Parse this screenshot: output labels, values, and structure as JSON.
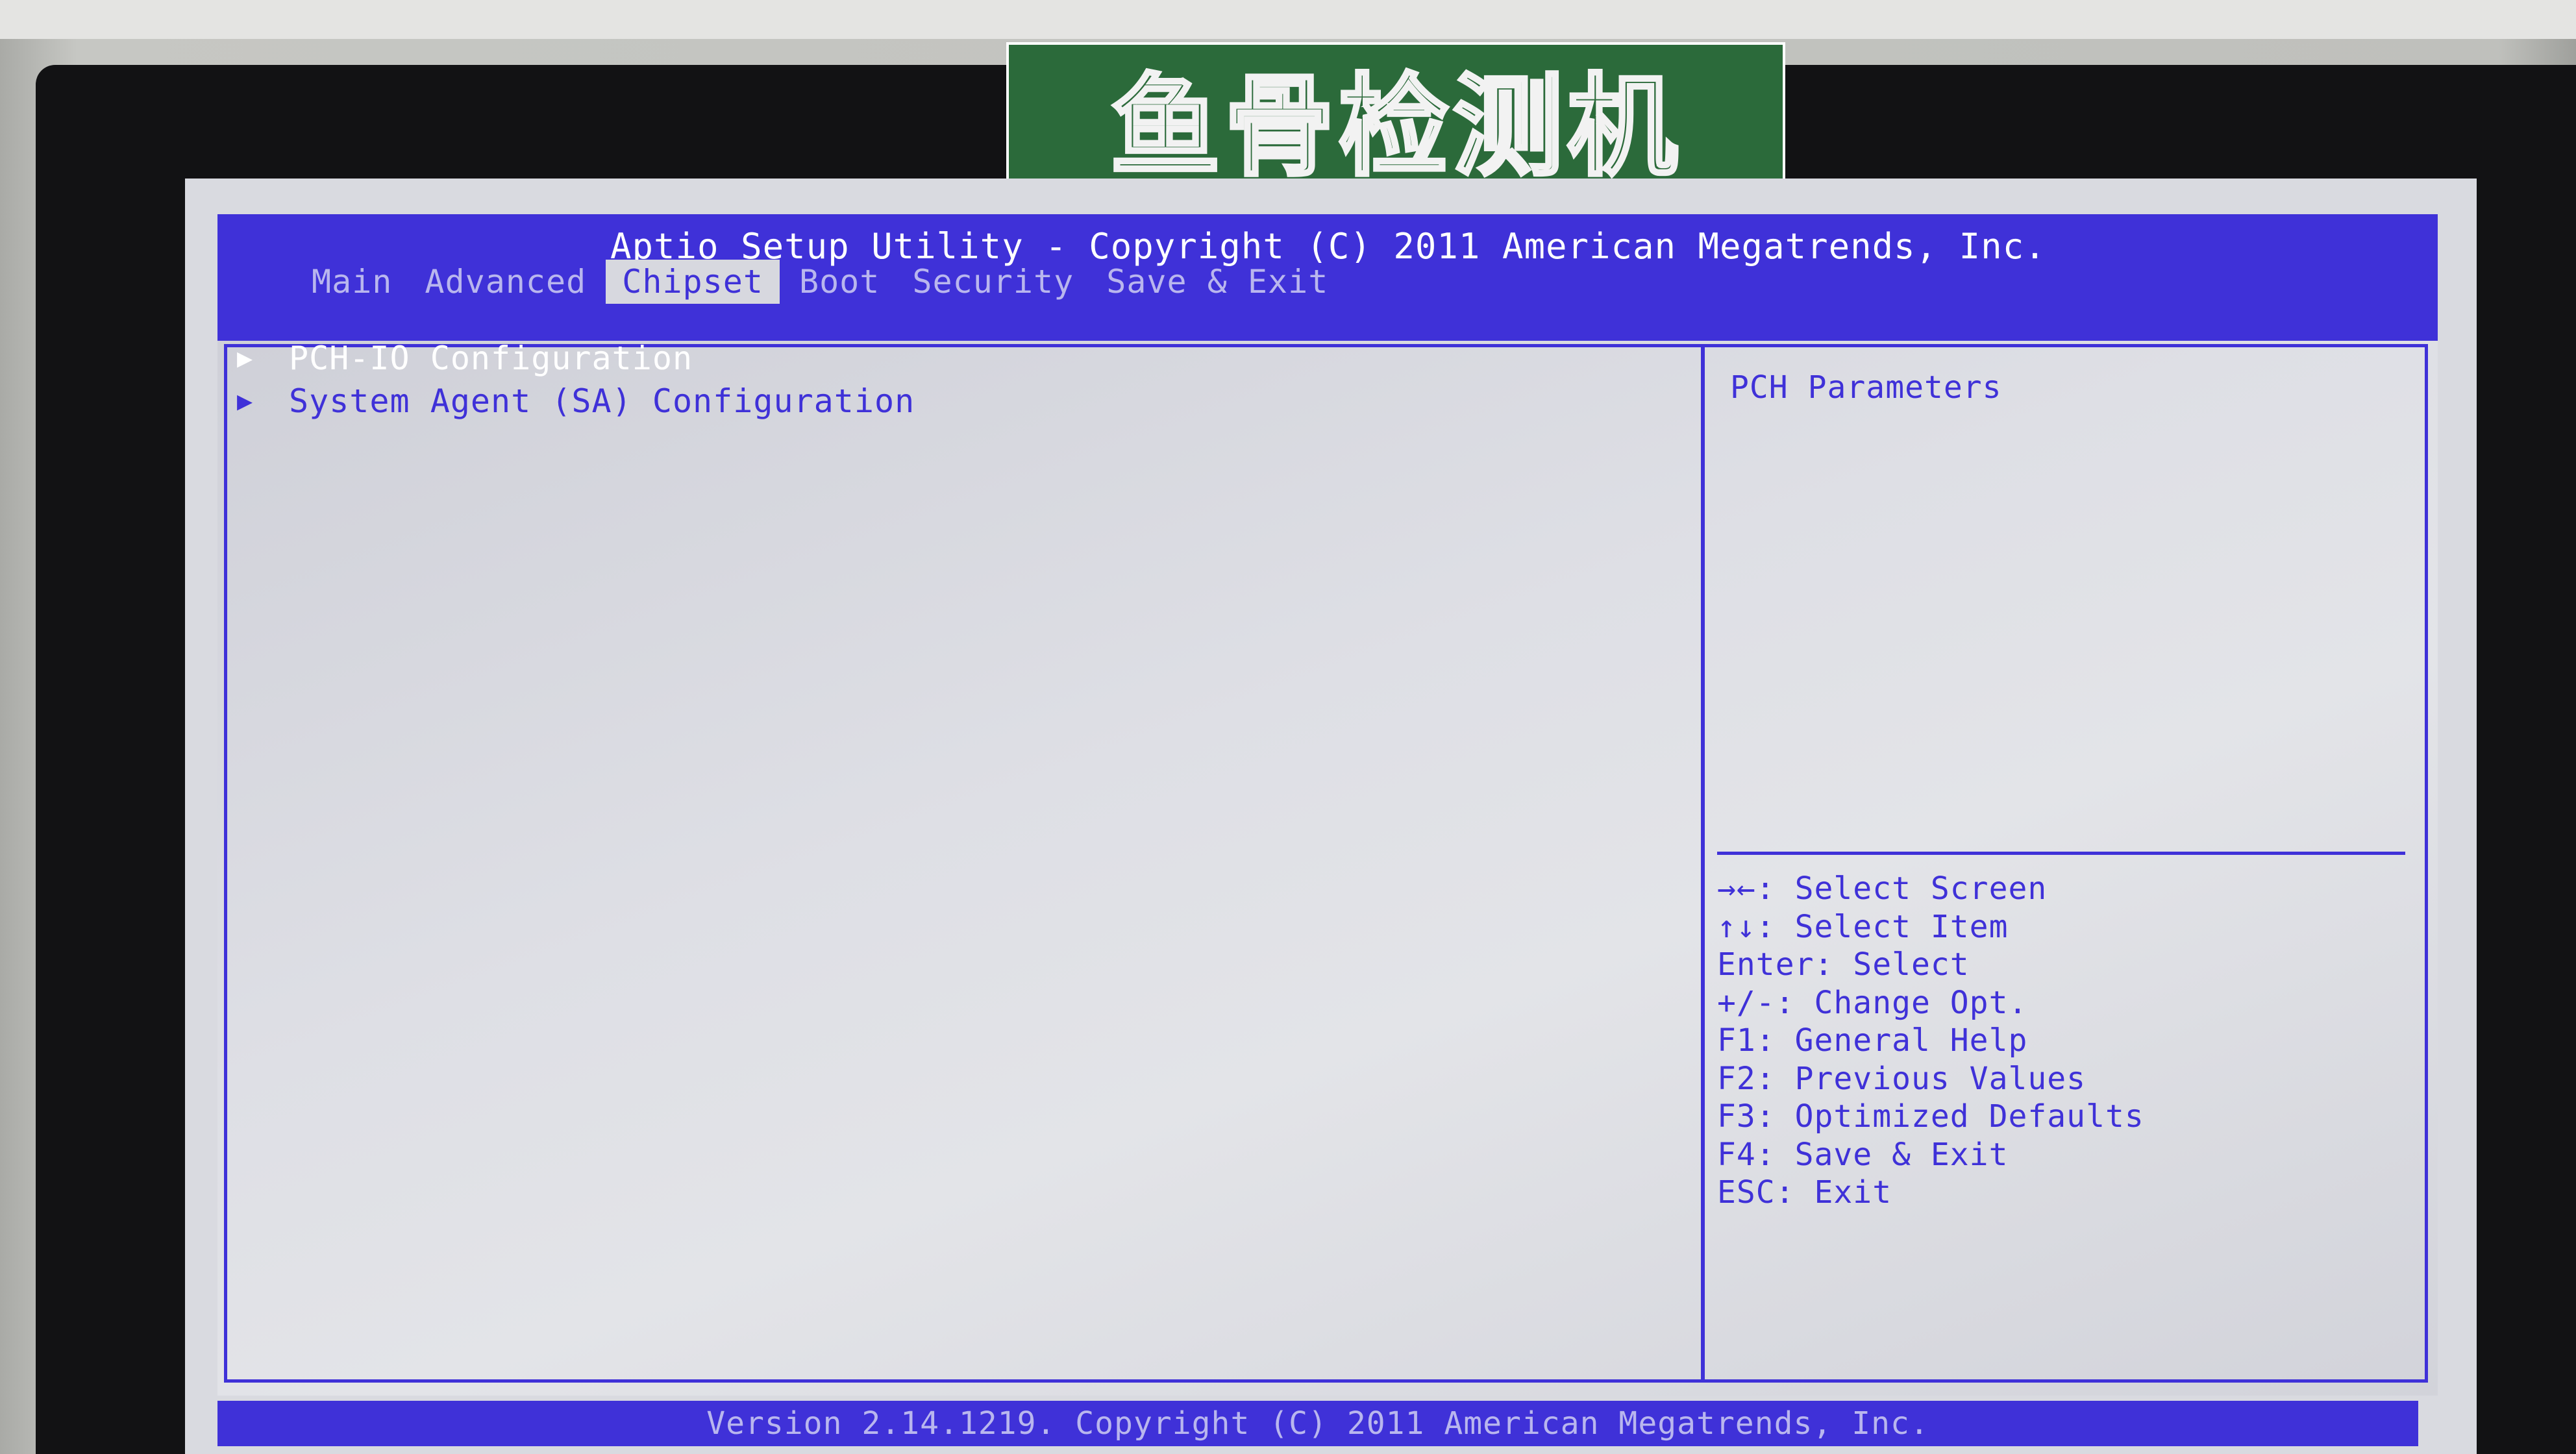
{
  "label": {
    "text": "鱼骨检测机"
  },
  "bios": {
    "title": "Aptio Setup Utility - Copyright (C) 2011 American Megatrends, Inc.",
    "tabs": [
      {
        "label": "Main"
      },
      {
        "label": "Advanced"
      },
      {
        "label": "Chipset",
        "active": true
      },
      {
        "label": "Boot"
      },
      {
        "label": "Security"
      },
      {
        "label": "Save & Exit"
      }
    ],
    "menu": [
      {
        "label": "PCH-IO Configuration",
        "arrow": "▶"
      },
      {
        "label": "System Agent (SA) Configuration",
        "arrow": "▶"
      }
    ],
    "help_text": "PCH Parameters",
    "keys": [
      "→←: Select Screen",
      "↑↓: Select Item",
      "Enter: Select",
      "+/-: Change Opt.",
      "F1: General Help",
      "F2: Previous Values",
      "F3: Optimized Defaults",
      "F4: Save & Exit",
      "ESC: Exit"
    ],
    "footer": "Version 2.14.1219. Copyright (C) 2011 American Megatrends, Inc."
  },
  "colors": {
    "accent": "#3f31d8",
    "panel_bg": "#dcdde3",
    "label_green": "#2b6a3a"
  }
}
